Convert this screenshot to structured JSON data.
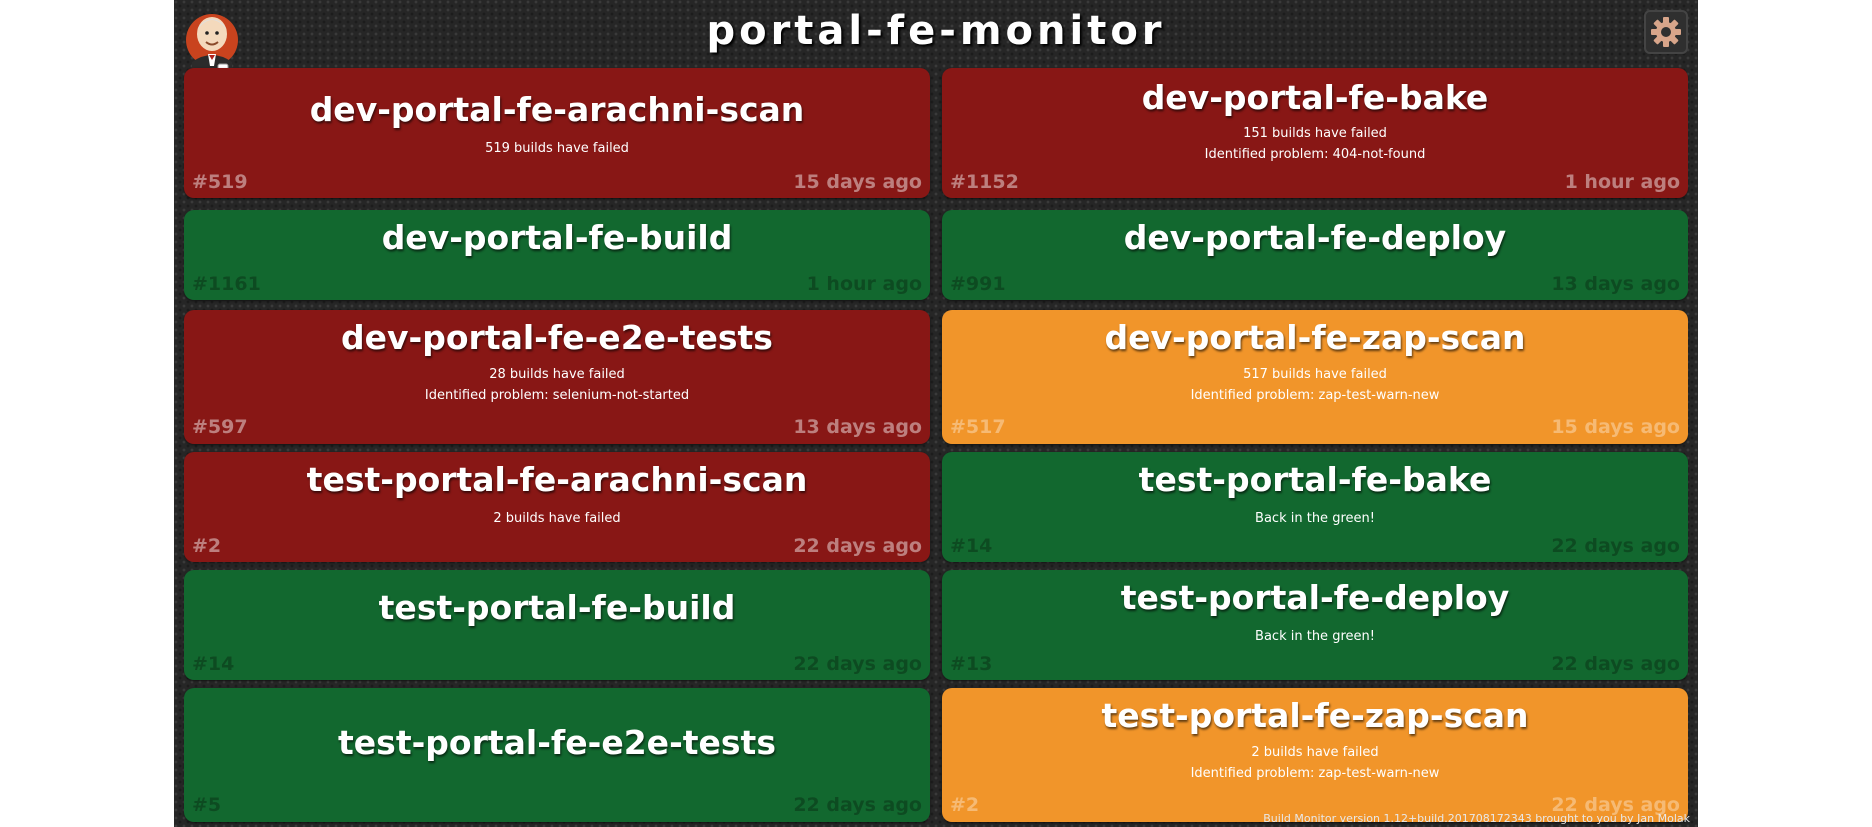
{
  "header": {
    "title": "portal-fe-monitor",
    "logo_icon": "jenkins-butler-icon",
    "settings_icon": "gear-icon"
  },
  "status_colors": {
    "failing": "#881715",
    "successful": "#12682f",
    "unstable": "#f1952a"
  },
  "jobs": [
    {
      "name": "dev-portal-fe-arachni-scan",
      "status": "failing",
      "lines": [
        "519 builds have failed"
      ],
      "build": "#519",
      "time": "15 days ago"
    },
    {
      "name": "dev-portal-fe-bake",
      "status": "failing",
      "lines": [
        "151 builds have failed",
        "Identified problem: 404-not-found"
      ],
      "build": "#1152",
      "time": "1 hour ago"
    },
    {
      "name": "dev-portal-fe-build",
      "status": "successful",
      "lines": [],
      "build": "#1161",
      "time": "1 hour ago"
    },
    {
      "name": "dev-portal-fe-deploy",
      "status": "successful",
      "lines": [],
      "build": "#991",
      "time": "13 days ago"
    },
    {
      "name": "dev-portal-fe-e2e-tests",
      "status": "failing",
      "lines": [
        "28 builds have failed",
        "Identified problem: selenium-not-started"
      ],
      "build": "#597",
      "time": "13 days ago"
    },
    {
      "name": "dev-portal-fe-zap-scan",
      "status": "unstable",
      "lines": [
        "517 builds have failed",
        "Identified problem: zap-test-warn-new"
      ],
      "build": "#517",
      "time": "15 days ago"
    },
    {
      "name": "test-portal-fe-arachni-scan",
      "status": "failing",
      "lines": [
        "2 builds have failed"
      ],
      "build": "#2",
      "time": "22 days ago"
    },
    {
      "name": "test-portal-fe-bake",
      "status": "successful",
      "lines": [
        "Back in the green!"
      ],
      "build": "#14",
      "time": "22 days ago"
    },
    {
      "name": "test-portal-fe-build",
      "status": "successful",
      "lines": [],
      "build": "#14",
      "time": "22 days ago"
    },
    {
      "name": "test-portal-fe-deploy",
      "status": "successful",
      "lines": [
        "Back in the green!"
      ],
      "build": "#13",
      "time": "22 days ago"
    },
    {
      "name": "test-portal-fe-e2e-tests",
      "status": "successful",
      "lines": [],
      "build": "#5",
      "time": "22 days ago"
    },
    {
      "name": "test-portal-fe-zap-scan",
      "status": "unstable",
      "lines": [
        "2 builds have failed",
        "Identified problem: zap-test-warn-new"
      ],
      "build": "#2",
      "time": "22 days ago"
    }
  ],
  "footer": {
    "text": "Build Monitor version 1.12+build.201708172343 brought to you by Jan Molak"
  }
}
